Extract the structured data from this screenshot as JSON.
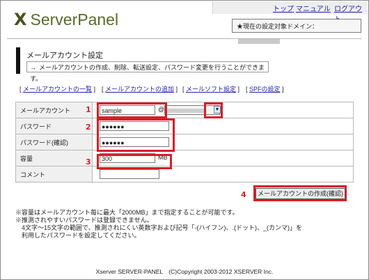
{
  "brand": {
    "mark": "X",
    "name": "ServerPanel"
  },
  "topnav": {
    "top": "トップ",
    "manual": "マニュアル",
    "logout": "ログアウト"
  },
  "domain_label": "★現在の設定対象ドメイン：",
  "page": {
    "title": "メールアカウント設定",
    "arrow": "→",
    "description": "メールアカウントの作成、削除、転送設定、パスワード変更を行うことができます。"
  },
  "links": [
    {
      "label": "メールアカウントの一覧"
    },
    {
      "label": "メールアカウントの追加"
    },
    {
      "label": "メールソフト設定"
    },
    {
      "label": "SPFの設定"
    }
  ],
  "form": {
    "account_label": "メールアカウント",
    "account_value": "sample",
    "at": "@",
    "password_label": "パスワード",
    "password_value": "●●●●●●",
    "password_confirm_label": "パスワード(確認)",
    "password_confirm_value": "●●●●●●",
    "capacity_label": "容量",
    "capacity_value": "300",
    "capacity_unit": "MB",
    "comment_label": "コメント",
    "comment_value": ""
  },
  "markers": [
    "1",
    "2",
    "3",
    "4"
  ],
  "create_button": "メールアカウントの作成(確認)",
  "notes": [
    "※容量はメールアカウント毎に最大「2000MB」まで指定することが可能です。",
    "※推測されやすいパスワードは登録できません。",
    "　4文字〜15文字の範囲で、推測されにくい英数字および記号「-(ハイフン)、.(ドット)、_(カンマ)」を",
    "　利用したパスワードを設定してください。"
  ],
  "footer": "Xserver SERVER-PANEL　(C)Copyright 2003-2012 XSERVER Inc.",
  "colors": {
    "highlight": "#d81e27",
    "link": "#2222aa",
    "brand": "#4b5320"
  }
}
